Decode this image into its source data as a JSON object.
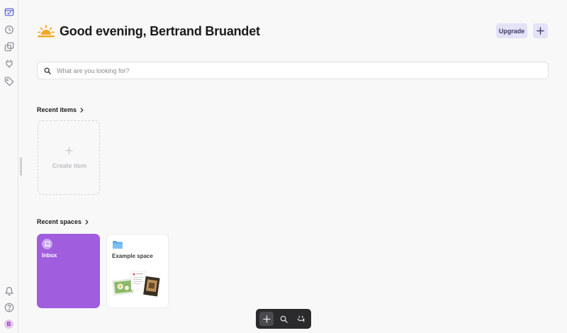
{
  "sidebar": {
    "items": [
      {
        "icon": "spaces-icon",
        "active": true
      },
      {
        "icon": "history-icon"
      },
      {
        "icon": "layers-icon"
      },
      {
        "icon": "plug-icon"
      },
      {
        "icon": "tag-icon"
      }
    ],
    "bottom": [
      {
        "icon": "bell-icon"
      },
      {
        "icon": "help-icon"
      }
    ],
    "avatar_initial": "B"
  },
  "header": {
    "greeting_icon": "sunset-icon",
    "title": "Good evening, Bertrand Bruandet",
    "upgrade_label": "Upgrade",
    "add_icon": "plus-icon"
  },
  "search": {
    "placeholder": "What are you looking for?",
    "value": ""
  },
  "recent_items": {
    "heading": "Recent items",
    "create_label": "Create item"
  },
  "recent_spaces": {
    "heading": "Recent spaces",
    "spaces": [
      {
        "label": "Inbox",
        "icon": "bookmark-icon",
        "color": "#a05ddd"
      },
      {
        "label": "Example space",
        "icon": "folder-icon",
        "color": "#5aa9e6"
      }
    ]
  },
  "toolbar": {
    "buttons": [
      "plus-icon",
      "search-icon",
      "smile-icon"
    ]
  },
  "colors": {
    "accent": "#5b5bd6",
    "upgrade_bg": "#e4e2f7",
    "inbox": "#a05ddd",
    "toolbar_bg": "#2b2b2e"
  }
}
